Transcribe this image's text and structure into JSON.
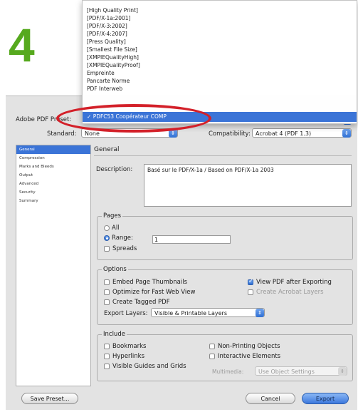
{
  "step": "4",
  "dialog": {
    "preset_label": "Adobe PDF Preset:",
    "standard_label": "Standard:",
    "standard_value": "None",
    "compatibility_label": "Compatibility:",
    "compatibility_value": "Acrobat 4 (PDF 1.3)"
  },
  "preset_menu": {
    "items": [
      "[High Quality Print]",
      "[PDF/X-1a:2001]",
      "[PDF/X-3:2002]",
      "[PDF/X-4:2007]",
      "[Press Quality]",
      "[Smallest File Size]",
      "[XMPIEQualityHigh]",
      "[XMPIEQualityProof]",
      "Empreinte",
      "Pancarte Norme",
      "PDF Interweb"
    ],
    "selected": "PDFC53 Coopérateur COMP",
    "check_mark": "✓"
  },
  "sidebar": {
    "items": [
      "General",
      "Compression",
      "Marks and Bleeds",
      "Output",
      "Advanced",
      "Security",
      "Summary"
    ]
  },
  "general": {
    "title": "General",
    "description_label": "Description:",
    "description_value": "Basé sur le PDF/X-1a / Based on PDF/X-1a 2003"
  },
  "pages": {
    "title": "Pages",
    "all_label": "All",
    "range_label": "Range:",
    "range_value": "1",
    "spreads_label": "Spreads"
  },
  "options": {
    "title": "Options",
    "embed_thumbnails": "Embed Page Thumbnails",
    "optimize_web": "Optimize for Fast Web View",
    "create_tagged": "Create Tagged PDF",
    "view_after": "View PDF after Exporting",
    "create_layers": "Create Acrobat Layers",
    "export_layers_label": "Export Layers:",
    "export_layers_value": "Visible & Printable Layers"
  },
  "include": {
    "title": "Include",
    "bookmarks": "Bookmarks",
    "hyperlinks": "Hyperlinks",
    "visible_guides": "Visible Guides and Grids",
    "non_printing": "Non-Printing Objects",
    "interactive": "Interactive Elements",
    "multimedia_label": "Multimedia:",
    "multimedia_value": "Use Object Settings"
  },
  "buttons": {
    "save_preset": "Save Preset...",
    "cancel": "Cancel",
    "export": "Export"
  },
  "colors": {
    "step_green": "#56a91e",
    "highlight_red": "#d32029",
    "selection_blue": "#3b74d7"
  }
}
